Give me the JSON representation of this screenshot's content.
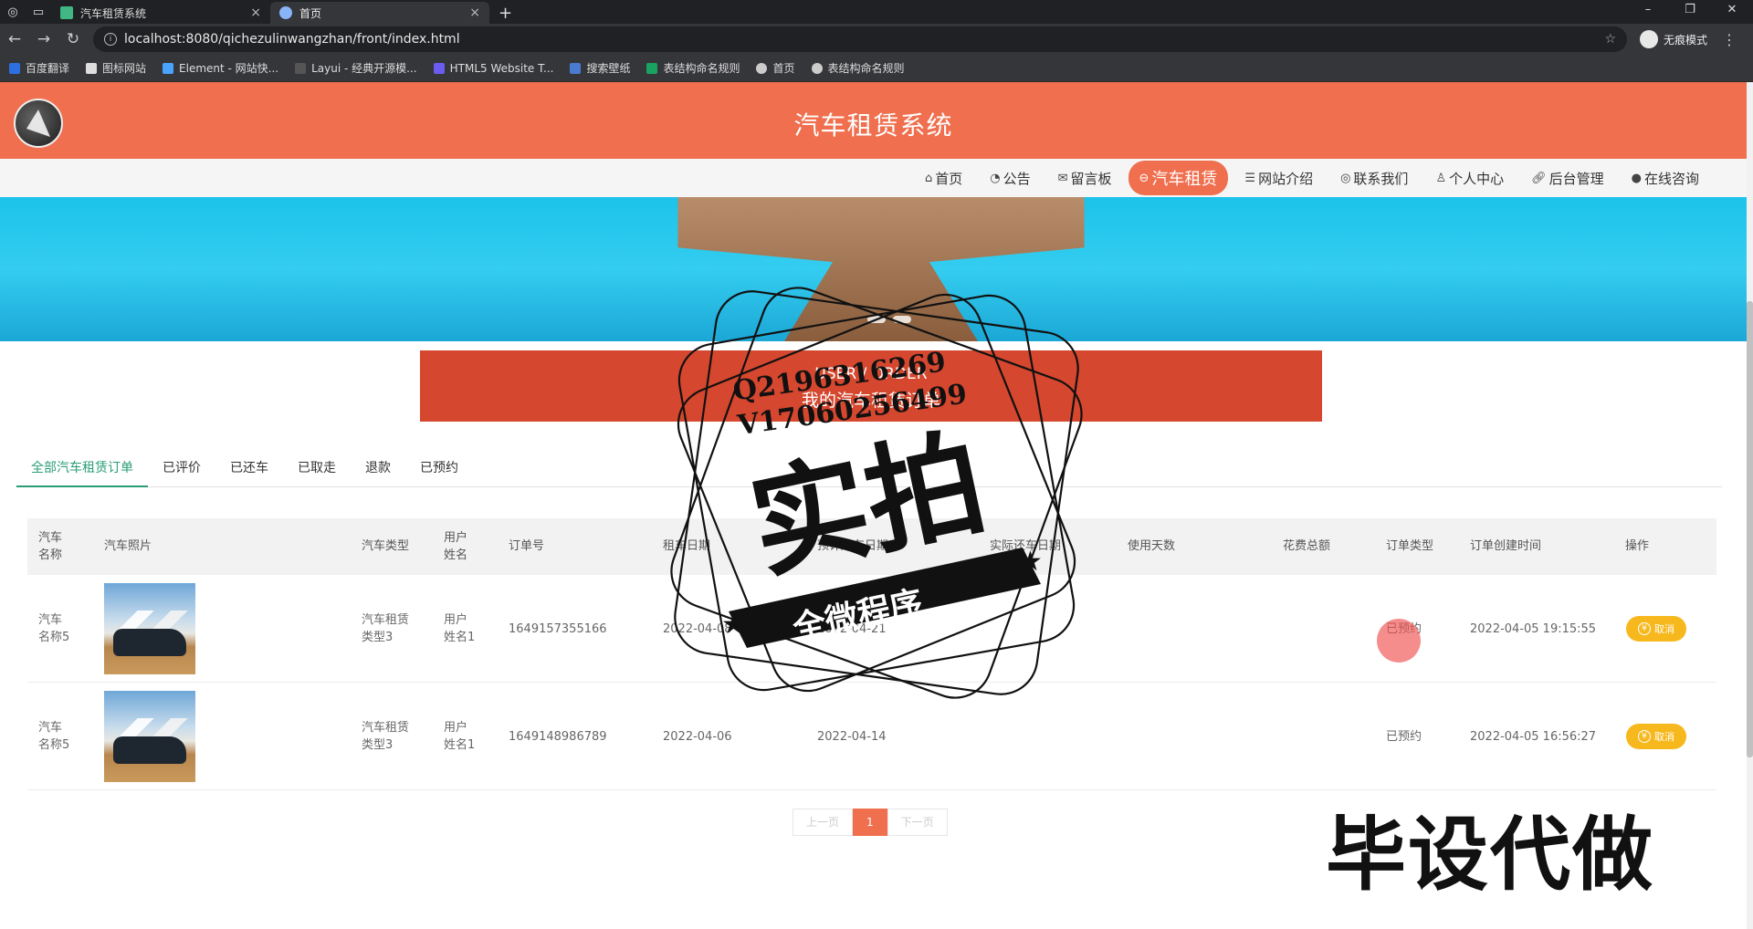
{
  "browser": {
    "tabs": [
      {
        "title": "汽车租赁系统",
        "active": false
      },
      {
        "title": "首页",
        "active": true
      }
    ],
    "url": "localhost:8080/qichezulinwangzhan/front/index.html",
    "incognito_label": "无痕模式",
    "bookmarks": [
      "百度翻译",
      "图标网站",
      "Element - 网站快...",
      "Layui - 经典开源模...",
      "HTML5 Website T...",
      "搜索壁纸",
      "表结构命名规则",
      "首页",
      "表结构命名规则"
    ]
  },
  "site": {
    "title": "汽车租赁系统",
    "nav": [
      {
        "label": "首页",
        "icon": "home-icon",
        "active": false
      },
      {
        "label": "公告",
        "icon": "bell-icon",
        "active": false
      },
      {
        "label": "留言板",
        "icon": "mail-icon",
        "active": false
      },
      {
        "label": "汽车租赁",
        "icon": "car-icon",
        "active": true
      },
      {
        "label": "网站介绍",
        "icon": "sliders-icon",
        "active": false
      },
      {
        "label": "联系我们",
        "icon": "globe-icon",
        "active": false
      },
      {
        "label": "个人中心",
        "icon": "user-icon",
        "active": false
      },
      {
        "label": "后台管理",
        "icon": "link-icon",
        "active": false
      },
      {
        "label": "在线咨询",
        "icon": "chat-icon",
        "active": false
      }
    ]
  },
  "order_box": {
    "en": "USER / ORDER",
    "cn": "我的汽车租赁订单"
  },
  "filter_tabs": [
    {
      "label": "全部汽车租赁订单",
      "active": true
    },
    {
      "label": "已评价",
      "active": false
    },
    {
      "label": "已还车",
      "active": false
    },
    {
      "label": "已取走",
      "active": false
    },
    {
      "label": "退款",
      "active": false
    },
    {
      "label": "已预约",
      "active": false
    }
  ],
  "table": {
    "headers": [
      "汽车名称",
      "汽车照片",
      "汽车类型",
      "用户姓名",
      "订单号",
      "租车日期",
      "预计还车日期",
      "实际还车日期",
      "使用天数",
      "花费总额",
      "订单类型",
      "订单创建时间",
      "操作"
    ],
    "rows": [
      {
        "car_name": "汽车名称5",
        "car_type": "汽车租赁类型3",
        "user": "用户姓名1",
        "order_no": "1649157355166",
        "rent_date": "2022-04-08",
        "expected_return": "2022-04-21",
        "actual_return": "",
        "days": "",
        "total": "",
        "order_type": "已预约",
        "created": "2022-04-05 19:15:55",
        "action": "取消"
      },
      {
        "car_name": "汽车名称5",
        "car_type": "汽车租赁类型3",
        "user": "用户姓名1",
        "order_no": "1649148986789",
        "rent_date": "2022-04-06",
        "expected_return": "2022-04-14",
        "actual_return": "",
        "days": "",
        "total": "",
        "order_type": "已预约",
        "created": "2022-04-05 16:56:27",
        "action": "取消"
      }
    ]
  },
  "pager": {
    "prev": "上一页",
    "current": "1",
    "next": "下一页"
  },
  "watermark": {
    "qq": "Q2196316269",
    "wx": "V17060256499",
    "big": "实拍",
    "ribbon": "全微程序",
    "corner": "毕设代做"
  }
}
